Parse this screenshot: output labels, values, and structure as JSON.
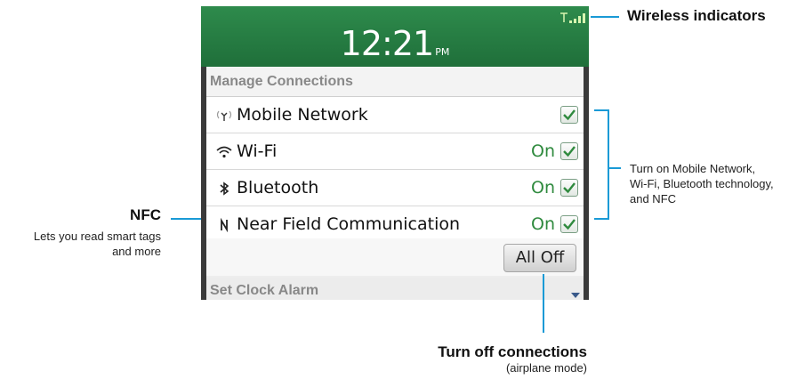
{
  "device": {
    "time": "12:21",
    "ampm": "PM",
    "signal_icon": "signal-bars-icon"
  },
  "manage": {
    "heading": "Manage Connections",
    "items": [
      {
        "label": "Mobile Network",
        "status": "",
        "checked": true,
        "icon": "antenna-icon"
      },
      {
        "label": "Wi-Fi",
        "status": "On",
        "checked": true,
        "icon": "wifi-icon"
      },
      {
        "label": "Bluetooth",
        "status": "On",
        "checked": true,
        "icon": "bluetooth-icon"
      },
      {
        "label": "Near Field Communication",
        "status": "On",
        "checked": true,
        "icon": "nfc-icon"
      }
    ],
    "all_off_label": "All Off",
    "next_section": "Set Clock Alarm"
  },
  "callouts": {
    "wireless": {
      "title": "Wireless indicators"
    },
    "turn_on": {
      "text": [
        "Turn on Mobile Network,",
        "Wi-Fi, Bluetooth technology,",
        "and NFC"
      ]
    },
    "nfc": {
      "title": "NFC",
      "text": [
        "Lets you read smart tags",
        "and more"
      ]
    },
    "turn_off": {
      "title": "Turn off connections",
      "sub": "(airplane mode)"
    }
  },
  "colors": {
    "accent": "#1a9ad6",
    "status_green": "#2f8a3e",
    "header_green": "#2e8b4c"
  }
}
